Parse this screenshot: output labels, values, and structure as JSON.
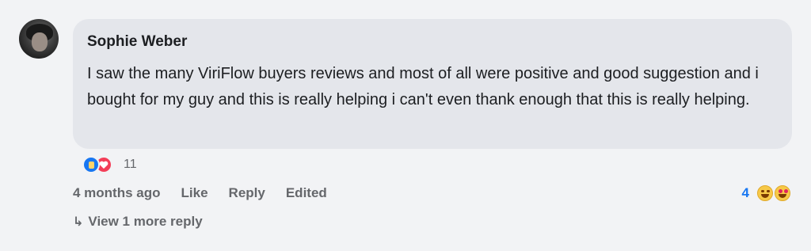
{
  "comment": {
    "author": "Sophie Weber",
    "text": "I saw the many ViriFlow buyers reviews and most of all were positive and good suggestion and i bought for my guy and this is really helping i can't even thank enough that this is really helping.",
    "reaction_count": "11",
    "reaction_icons": [
      "like-icon",
      "love-icon"
    ],
    "time": "4 months ago",
    "actions": {
      "like": "Like",
      "reply": "Reply",
      "edited": "Edited"
    },
    "right_reactions": {
      "count": "4",
      "icons": [
        "laugh-emoji-icon",
        "heart-eyes-emoji-icon"
      ]
    },
    "view_replies": "View 1 more reply",
    "view_replies_arrow": "↳"
  },
  "colors": {
    "bubble": "#e4e6eb",
    "background": "#f2f3f5",
    "accent": "#1877f2",
    "muted": "#65676b"
  }
}
